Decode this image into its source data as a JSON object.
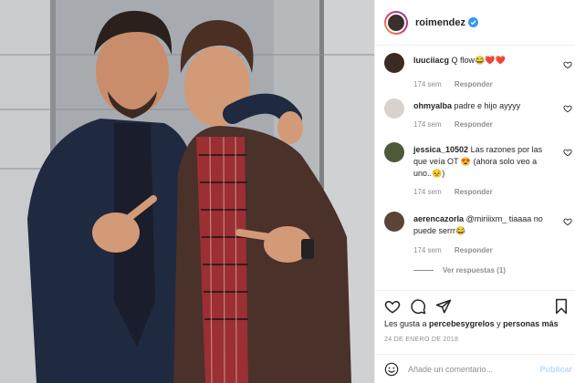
{
  "post": {
    "username": "roimendez",
    "likes_prefix": "Les gusta a ",
    "likes_user": "percebesygrelos",
    "likes_connector": " y ",
    "likes_more": "personas más",
    "date": "24 DE ENERO DE 2018"
  },
  "comments": [
    {
      "user": "luuciiacg",
      "text": "Q flow😂❤️❤️",
      "time": "174 sem",
      "reply": "Responder",
      "avatar_color": "#3b2a22"
    },
    {
      "user": "ohmyalba",
      "text": "padre e hijo ayyyy",
      "time": "174 sem",
      "reply": "Responder",
      "avatar_color": "#d8d2cc"
    },
    {
      "user": "jessica_10502",
      "text": "Las razones por las que veía OT 😍 (ahora solo veo a uno..😣)",
      "time": "174 sem",
      "reply": "Responder",
      "avatar_color": "#4c5a3a"
    },
    {
      "user": "aerencazorla",
      "text": "@miriiixm_ tiaaaa no puede serrr😂",
      "time": "174 sem",
      "reply": "Responder",
      "avatar_color": "#5a4438"
    }
  ],
  "view_replies": "Ver respuestas (1)",
  "add_comment": {
    "placeholder": "Añade un comentario...",
    "publish": "Publicar"
  },
  "colors": {
    "accent": "#0095f6",
    "publish_disabled": "#b3dbff",
    "verified": "#3897f0",
    "muted": "#8e8e8e"
  },
  "icons": [
    "verified-icon",
    "heart-icon",
    "comment-icon",
    "share-icon",
    "bookmark-icon",
    "smile-icon"
  ]
}
